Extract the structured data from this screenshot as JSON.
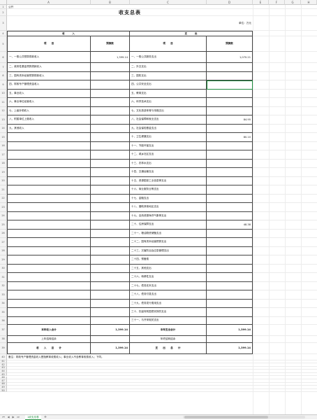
{
  "columns": [
    "A",
    "B",
    "C",
    "D",
    "E",
    "F",
    "G",
    "H"
  ],
  "sheet_label": "公开",
  "title": "收支总表",
  "unit": "单位：万元",
  "income_header": "收　　　入",
  "expense_header": "支　　　出",
  "col_item": "项　　目",
  "col_budget": "预算数",
  "income_items": [
    {
      "label": "一、一般公共预算拨款收入",
      "value": "1,399.14"
    },
    {
      "label": "二、政府性基金预算拨款收入",
      "value": ""
    },
    {
      "label": "三、国有资本经营预算拨款收入",
      "value": ""
    },
    {
      "label": "四、财政专户管理资金收入",
      "value": ""
    },
    {
      "label": "五、事业收入",
      "value": ""
    },
    {
      "label": "六、事业单位经营收入",
      "value": ""
    },
    {
      "label": "七、上级补助收入",
      "value": ""
    },
    {
      "label": "八、附属单位上缴收入",
      "value": ""
    },
    {
      "label": "九、其他收入",
      "value": ""
    }
  ],
  "expense_items": [
    {
      "label": "一、一般公共服务支出",
      "value": "1,070.21"
    },
    {
      "label": "二、外交支出",
      "value": ""
    },
    {
      "label": "三、国防支出",
      "value": ""
    },
    {
      "label": "四、公共安全支出",
      "value": ""
    },
    {
      "label": "五、教育支出",
      "value": ""
    },
    {
      "label": "六、科学技术支出",
      "value": ""
    },
    {
      "label": "七、文化旅游体育与传媒支出",
      "value": ""
    },
    {
      "label": "八、社会保障和就业支出",
      "value": "84.95"
    },
    {
      "label": "九、社会保险基金支出",
      "value": ""
    },
    {
      "label": "十、卫生健康支出",
      "value": "80.10"
    },
    {
      "label": "十一、节能环保支出",
      "value": ""
    },
    {
      "label": "十二、城乡社区支出",
      "value": ""
    },
    {
      "label": "十三、农林水支出",
      "value": ""
    },
    {
      "label": "十四、交通运输支出",
      "value": ""
    },
    {
      "label": "十五、资源勘探工业信息等支出",
      "value": ""
    },
    {
      "label": "十六、商业服务业等支出",
      "value": ""
    },
    {
      "label": "十七、金融支出",
      "value": ""
    },
    {
      "label": "十八、援助其他地区支出",
      "value": ""
    },
    {
      "label": "十九、自然资源海洋气象等支出",
      "value": ""
    },
    {
      "label": "二十、住房保障支出",
      "value": "48.38"
    },
    {
      "label": "二十一、粮油物资储备支出",
      "value": ""
    },
    {
      "label": "二十二、国有资本经营预算支出",
      "value": ""
    },
    {
      "label": "二十三、灾害防治及应急管理支出",
      "value": ""
    },
    {
      "label": "二十四、预备费",
      "value": ""
    },
    {
      "label": "二十五、其他支出",
      "value": ""
    },
    {
      "label": "二十六、转移性支出",
      "value": ""
    },
    {
      "label": "二十七、债务还本支出",
      "value": ""
    },
    {
      "label": "二十八、债务付息支出",
      "value": ""
    },
    {
      "label": "二十九、债务发行费用支出",
      "value": ""
    },
    {
      "label": "三十、抗疫特别国债安排的支出",
      "value": ""
    },
    {
      "label": "三十一、与开采相关支出",
      "value": ""
    }
  ],
  "totals": {
    "income_year_label": "本年收入合计",
    "income_year_value": "1,399.14",
    "expense_year_label": "本年支出合计",
    "expense_year_value": "1,399.14",
    "carry_over_label": "上年结转结余",
    "carry_forward_label": "年终结转结余",
    "income_total_label": "收　　入　　总　　计",
    "income_total_value": "1,399.14",
    "expense_total_label": "支　　出　　总　　计",
    "expense_total_value": "1,399.14"
  },
  "note": "备注：财政专户管理资金收入是指教育收费收入；事业收入不含教育收费收入；下同。",
  "tab": {
    "name": "1收支总表",
    "add": "+"
  }
}
